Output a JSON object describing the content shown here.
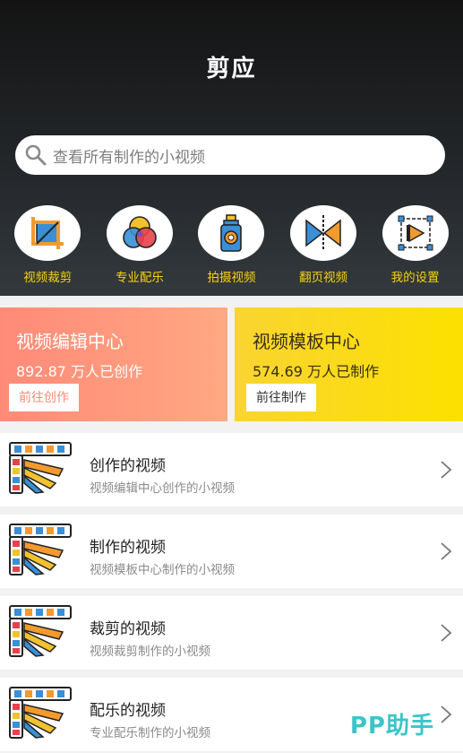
{
  "header": {
    "title": "剪应",
    "search_placeholder": "查看所有制作的小视频"
  },
  "shortcuts": [
    {
      "label": "视频裁剪",
      "icon": "crop-icon"
    },
    {
      "label": "专业配乐",
      "icon": "color-circles-icon"
    },
    {
      "label": "拍摄视频",
      "icon": "spray-camera-icon"
    },
    {
      "label": "翻页视频",
      "icon": "page-flip-icon"
    },
    {
      "label": "我的设置",
      "icon": "settings-play-icon"
    }
  ],
  "cards": {
    "edit": {
      "title": "视频编辑中心",
      "stat": "892.87 万人已创作",
      "button": "前往创作"
    },
    "template": {
      "title": "视频模板中心",
      "stat": "574.69 万人已制作",
      "button": "前往制作"
    }
  },
  "list": [
    {
      "title": "创作的视频",
      "subtitle": "视频编辑中心创作的小视频"
    },
    {
      "title": "制作的视频",
      "subtitle": "视频模板中心制作的小视频"
    },
    {
      "title": "裁剪的视频",
      "subtitle": "视频裁剪制作的小视频"
    },
    {
      "title": "配乐的视频",
      "subtitle": "专业配乐制作的小视频"
    }
  ],
  "watermark": "PP助手",
  "colors": {
    "accent_yellow": "#f5d312",
    "edit_card": "#ff8a78",
    "template_card": "#fbe100",
    "watermark": "#3ac6c8"
  }
}
